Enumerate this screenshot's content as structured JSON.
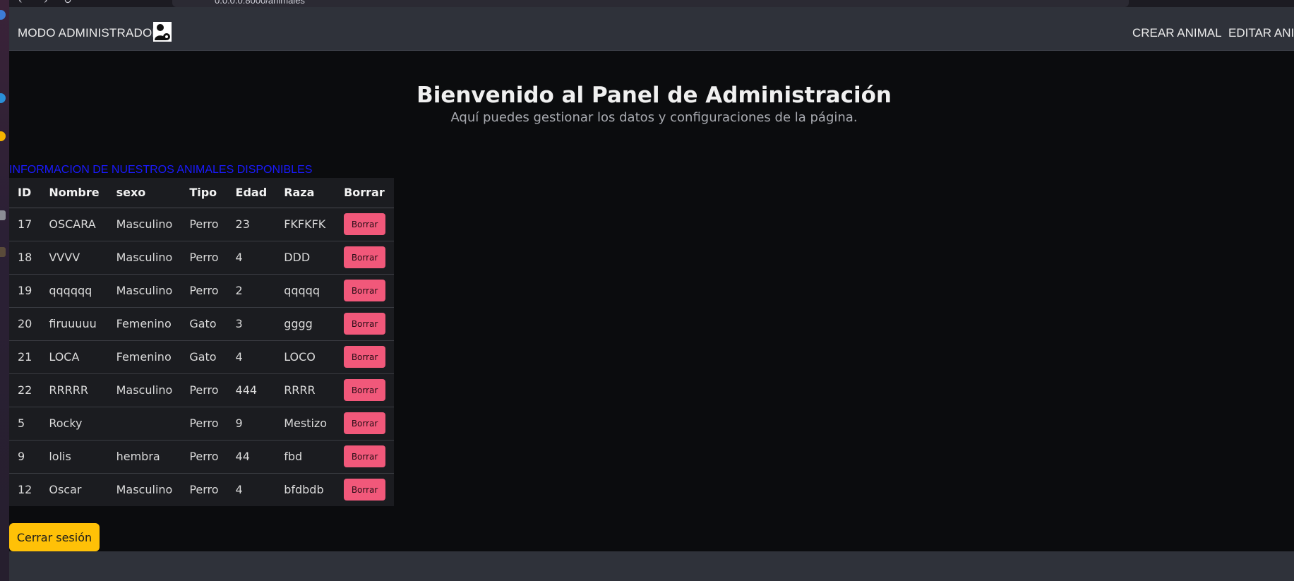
{
  "browser": {
    "url": "0.0.0.0:8000/animales"
  },
  "navbar": {
    "brand": "MODO ADMINISTRADOR",
    "brand_icon": "admin-gear-icon",
    "links": [
      "CREAR ANIMAL",
      "EDITAR ANIM"
    ]
  },
  "hero": {
    "title": "Bienvenido al Panel de Administración",
    "subtitle": "Aquí puedes gestionar los datos y configuraciones de la página."
  },
  "table": {
    "caption": "INFORMACION DE NUESTROS ANIMALES DISPONIBLES",
    "headers": [
      "ID",
      "Nombre",
      "sexo",
      "Tipo",
      "Edad",
      "Raza",
      "Borrar"
    ],
    "rows": [
      {
        "id": "17",
        "nombre": "OSCARA",
        "sexo": "Masculino",
        "tipo": "Perro",
        "edad": "23",
        "raza": "FKFKFK"
      },
      {
        "id": "18",
        "nombre": "VVVV",
        "sexo": "Masculino",
        "tipo": "Perro",
        "edad": "4",
        "raza": "DDD"
      },
      {
        "id": "19",
        "nombre": "qqqqqq",
        "sexo": "Masculino",
        "tipo": "Perro",
        "edad": "2",
        "raza": "qqqqq"
      },
      {
        "id": "20",
        "nombre": "firuuuuu",
        "sexo": "Femenino",
        "tipo": "Gato",
        "edad": "3",
        "raza": "gggg"
      },
      {
        "id": "21",
        "nombre": "LOCA",
        "sexo": "Femenino",
        "tipo": "Gato",
        "edad": "4",
        "raza": "LOCO"
      },
      {
        "id": "22",
        "nombre": "RRRRR",
        "sexo": "Masculino",
        "tipo": "Perro",
        "edad": "444",
        "raza": "RRRR"
      },
      {
        "id": "5",
        "nombre": "Rocky",
        "sexo": "",
        "tipo": "Perro",
        "edad": "9",
        "raza": "Mestizo"
      },
      {
        "id": "9",
        "nombre": "lolis",
        "sexo": "hembra",
        "tipo": "Perro",
        "edad": "44",
        "raza": "fbd"
      },
      {
        "id": "12",
        "nombre": "Oscar",
        "sexo": "Masculino",
        "tipo": "Perro",
        "edad": "4",
        "raza": "bfdbdb"
      }
    ],
    "delete_label": "Borrar"
  },
  "logout_label": "Cerrar sesión",
  "colors": {
    "navbar_bg": "#2f323a",
    "page_bg": "#0b0c0e",
    "delete_button": "#f1587a",
    "logout_button": "#ffc107",
    "caption_link": "#1a1aff"
  }
}
